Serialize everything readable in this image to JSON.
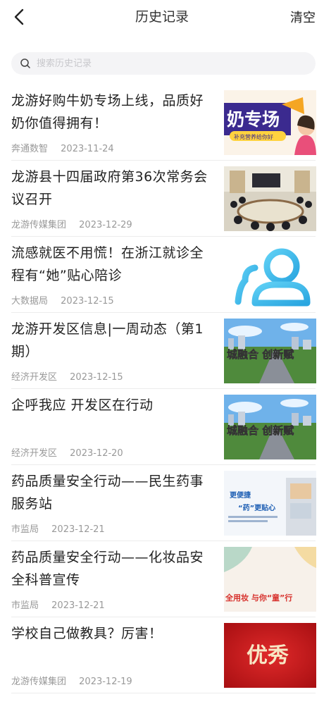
{
  "header": {
    "title": "历史记录",
    "clear_label": "清空"
  },
  "search": {
    "placeholder": "搜索历史记录"
  },
  "items": [
    {
      "title": "龙游好购牛奶专场上线，品质好奶你值得拥有！",
      "source": "奔通数智",
      "date": "2023-11-24",
      "thumb_text": "奶专场",
      "thumb_sub": "补充营养给你好"
    },
    {
      "title": "龙游县十四届政府第36次常务会议召开",
      "source": "龙游传媒集团",
      "date": "2023-12-29"
    },
    {
      "title": "流感就医不用慌！在浙江就诊全程有“她”贴心陪诊",
      "source": "大数据局",
      "date": "2023-12-15"
    },
    {
      "title": "龙游开发区信息|一周动态（第1期）",
      "source": "经济开发区",
      "date": "2023-12-15",
      "thumb_text": "城融合 创新赋"
    },
    {
      "title": "企呼我应 开发区在行动",
      "source": "经济开发区",
      "date": "2023-12-20",
      "thumb_text": "城融合 创新赋"
    },
    {
      "title": "药品质量安全行动——民生药事服务站",
      "source": "市监局",
      "date": "2023-12-21",
      "thumb_text_1": "更便捷",
      "thumb_text_2": "“药”更贴心"
    },
    {
      "title": "药品质量安全行动——化妆品安全科普宣传",
      "source": "市监局",
      "date": "2023-12-21",
      "thumb_text": "全用妆 与你“童”行"
    },
    {
      "title": "学校自己做教具？厉害！",
      "source": "龙游传媒集团",
      "date": "2023-12-19",
      "thumb_text": "优秀"
    }
  ],
  "colors": {
    "accent": "#3cb4e8",
    "muted": "#999999"
  }
}
